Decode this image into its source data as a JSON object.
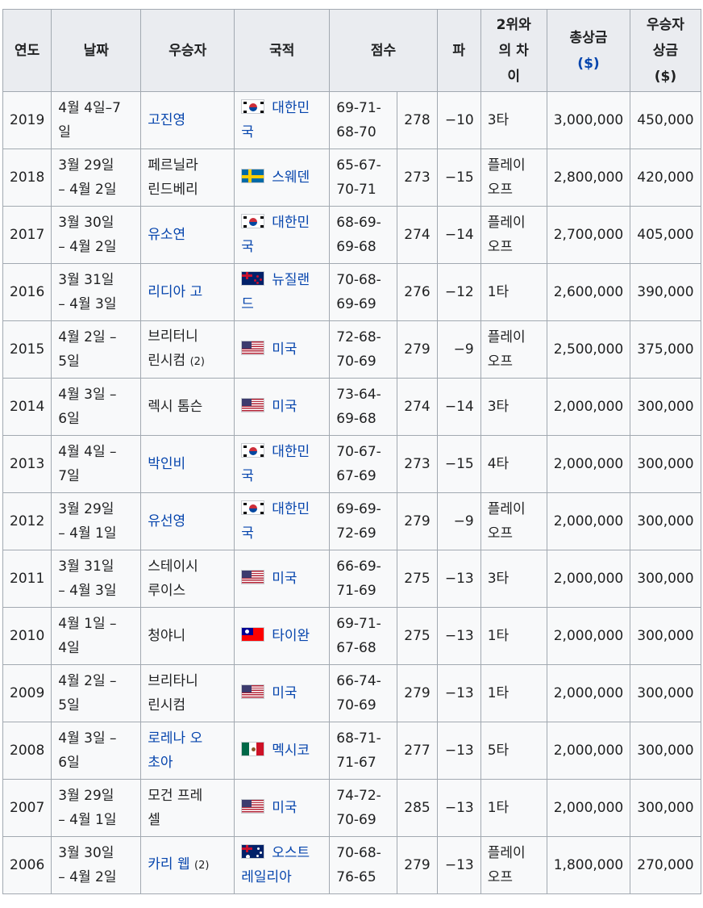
{
  "headers": {
    "year": "연도",
    "date": "날짜",
    "winner": "우승자",
    "nation": "국적",
    "score": "점수",
    "par": "파",
    "margin": [
      "2위와",
      "의 차",
      "이"
    ],
    "purse": "총상금",
    "purse_unit": "($)",
    "share": [
      "우승자",
      "상금"
    ],
    "share_unit": "($)"
  },
  "rows": [
    {
      "year": "2019",
      "date": [
        "4월 4일–7",
        "일"
      ],
      "winner": [
        "고진영"
      ],
      "winner_note": "",
      "winner_link": true,
      "flag": "flag-kr",
      "nation": [
        "대한민",
        "국"
      ],
      "score": [
        "69-71-",
        "68-70"
      ],
      "total": "278",
      "par": "−10",
      "margin": [
        "3타"
      ],
      "purse": "3,000,000",
      "share": "450,000"
    },
    {
      "year": "2018",
      "date": [
        "3월 29일",
        "– 4월 2일"
      ],
      "winner": [
        "페르닐라",
        "린드베리"
      ],
      "winner_note": "",
      "winner_link": false,
      "flag": "flag-se",
      "nation": [
        "스웨덴"
      ],
      "score": [
        "65-67-",
        "70-71"
      ],
      "total": "273",
      "par": "−15",
      "margin": [
        "플레이",
        "오프"
      ],
      "purse": "2,800,000",
      "share": "420,000"
    },
    {
      "year": "2017",
      "date": [
        "3월 30일",
        "– 4월 2일"
      ],
      "winner": [
        "유소연"
      ],
      "winner_note": "",
      "winner_link": true,
      "flag": "flag-kr",
      "nation": [
        "대한민",
        "국"
      ],
      "score": [
        "68-69-",
        "69-68"
      ],
      "total": "274",
      "par": "−14",
      "margin": [
        "플레이",
        "오프"
      ],
      "purse": "2,700,000",
      "share": "405,000"
    },
    {
      "year": "2016",
      "date": [
        "3월 31일",
        "– 4월 3일"
      ],
      "winner": [
        "리디아 고"
      ],
      "winner_note": "",
      "winner_link": true,
      "flag": "flag-nz",
      "nation": [
        "뉴질랜",
        "드"
      ],
      "score": [
        "70-68-",
        "69-69"
      ],
      "total": "276",
      "par": "−12",
      "margin": [
        "1타"
      ],
      "purse": "2,600,000",
      "share": "390,000"
    },
    {
      "year": "2015",
      "date": [
        "4월 2일 –",
        "5일"
      ],
      "winner": [
        "브리터니",
        "린시컴"
      ],
      "winner_note": "(2)",
      "winner_link": false,
      "flag": "flag-us",
      "nation": [
        "미국"
      ],
      "score": [
        "72-68-",
        "70-69"
      ],
      "total": "279",
      "par": "−9",
      "margin": [
        "플레이",
        "오프"
      ],
      "purse": "2,500,000",
      "share": "375,000"
    },
    {
      "year": "2014",
      "date": [
        "4월 3일 –",
        "6일"
      ],
      "winner": [
        "렉시 톰슨"
      ],
      "winner_note": "",
      "winner_link": false,
      "flag": "flag-us",
      "nation": [
        "미국"
      ],
      "score": [
        "73-64-",
        "69-68"
      ],
      "total": "274",
      "par": "−14",
      "margin": [
        "3타"
      ],
      "purse": "2,000,000",
      "share": "300,000"
    },
    {
      "year": "2013",
      "date": [
        "4월 4일 –",
        "7일"
      ],
      "winner": [
        "박인비"
      ],
      "winner_note": "",
      "winner_link": true,
      "flag": "flag-kr",
      "nation": [
        "대한민",
        "국"
      ],
      "score": [
        "70-67-",
        "67-69"
      ],
      "total": "273",
      "par": "−15",
      "margin": [
        "4타"
      ],
      "purse": "2,000,000",
      "share": "300,000"
    },
    {
      "year": "2012",
      "date": [
        "3월 29일",
        "– 4월 1일"
      ],
      "winner": [
        "유선영"
      ],
      "winner_note": "",
      "winner_link": true,
      "flag": "flag-kr",
      "nation": [
        "대한민",
        "국"
      ],
      "score": [
        "69-69-",
        "72-69"
      ],
      "total": "279",
      "par": "−9",
      "margin": [
        "플레이",
        "오프"
      ],
      "purse": "2,000,000",
      "share": "300,000"
    },
    {
      "year": "2011",
      "date": [
        "3월 31일",
        "– 4월 3일"
      ],
      "winner": [
        "스테이시",
        "루이스"
      ],
      "winner_note": "",
      "winner_link": false,
      "flag": "flag-us",
      "nation": [
        "미국"
      ],
      "score": [
        "66-69-",
        "71-69"
      ],
      "total": "275",
      "par": "−13",
      "margin": [
        "3타"
      ],
      "purse": "2,000,000",
      "share": "300,000"
    },
    {
      "year": "2010",
      "date": [
        "4월 1일 –",
        "4일"
      ],
      "winner": [
        "청야니"
      ],
      "winner_note": "",
      "winner_link": false,
      "flag": "flag-tw",
      "nation": [
        "타이완"
      ],
      "score": [
        "69-71-",
        "67-68"
      ],
      "total": "275",
      "par": "−13",
      "margin": [
        "1타"
      ],
      "purse": "2,000,000",
      "share": "300,000"
    },
    {
      "year": "2009",
      "date": [
        "4월 2일 –",
        "5일"
      ],
      "winner": [
        "브리타니",
        "린시컴"
      ],
      "winner_note": "",
      "winner_link": false,
      "flag": "flag-us",
      "nation": [
        "미국"
      ],
      "score": [
        "66-74-",
        "70-69"
      ],
      "total": "279",
      "par": "−13",
      "margin": [
        "1타"
      ],
      "purse": "2,000,000",
      "share": "300,000"
    },
    {
      "year": "2008",
      "date": [
        "4월 3일 –",
        "6일"
      ],
      "winner": [
        "로레나 오",
        "초아"
      ],
      "winner_note": "",
      "winner_link": true,
      "flag": "flag-mx",
      "nation": [
        "멕시코"
      ],
      "score": [
        "68-71-",
        "71-67"
      ],
      "total": "277",
      "par": "−13",
      "margin": [
        "5타"
      ],
      "purse": "2,000,000",
      "share": "300,000"
    },
    {
      "year": "2007",
      "date": [
        "3월 29일",
        "– 4월 1일"
      ],
      "winner": [
        "모건 프레",
        "셀"
      ],
      "winner_note": "",
      "winner_link": false,
      "flag": "flag-us",
      "nation": [
        "미국"
      ],
      "score": [
        "74-72-",
        "70-69"
      ],
      "total": "285",
      "par": "−13",
      "margin": [
        "1타"
      ],
      "purse": "2,000,000",
      "share": "300,000"
    },
    {
      "year": "2006",
      "date": [
        "3월 30일",
        "– 4월 2일"
      ],
      "winner": [
        "카리 웹"
      ],
      "winner_note": "(2)",
      "winner_link": true,
      "flag": "flag-au",
      "nation": [
        "오스트",
        "레일리아"
      ],
      "score": [
        "70-68-",
        "76-65"
      ],
      "total": "279",
      "par": "−13",
      "margin": [
        "플레이",
        "오프"
      ],
      "purse": "1,800,000",
      "share": "270,000"
    }
  ]
}
